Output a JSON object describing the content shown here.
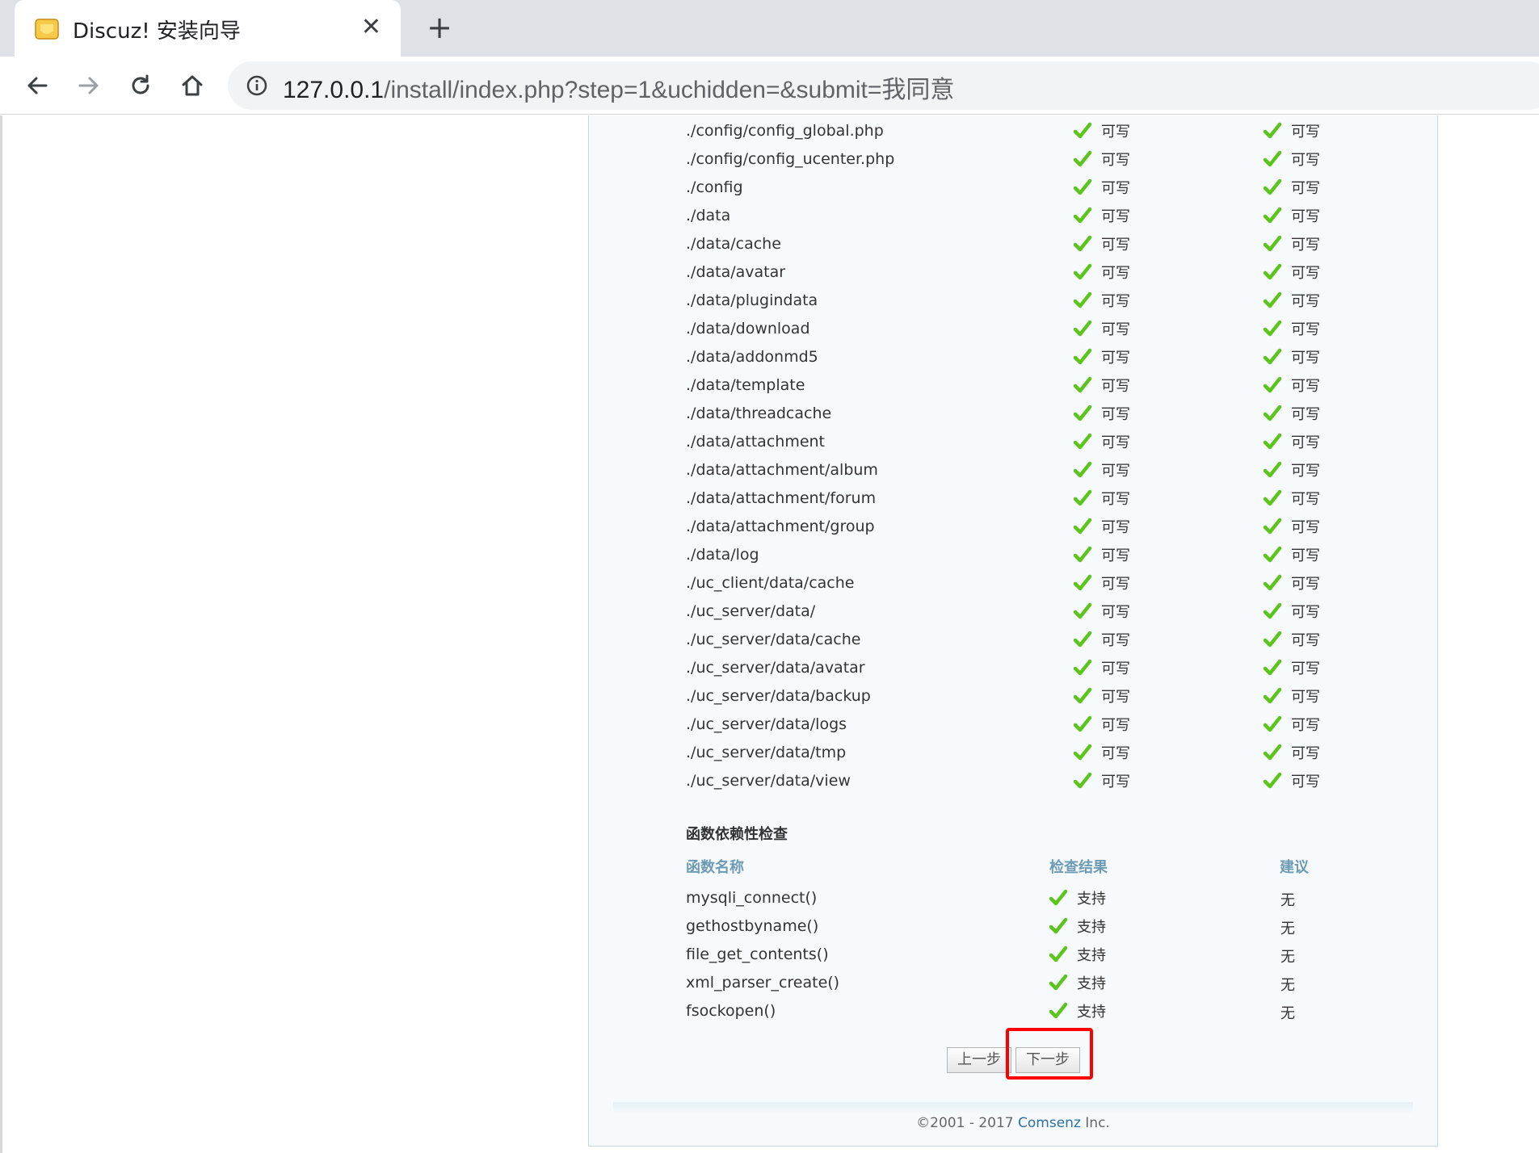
{
  "browser": {
    "tab_title": "Discuz! 安装向导",
    "favicon": "discuz-logo-icon",
    "url_host": "127.0.0.1",
    "url_path": "/install/index.php?step=1&uchidden=&submit=我同意"
  },
  "directory_check": {
    "rows": [
      {
        "path": "./config/config_global.php",
        "current": "可写",
        "required": "可写"
      },
      {
        "path": "./config/config_ucenter.php",
        "current": "可写",
        "required": "可写"
      },
      {
        "path": "./config",
        "current": "可写",
        "required": "可写"
      },
      {
        "path": "./data",
        "current": "可写",
        "required": "可写"
      },
      {
        "path": "./data/cache",
        "current": "可写",
        "required": "可写"
      },
      {
        "path": "./data/avatar",
        "current": "可写",
        "required": "可写"
      },
      {
        "path": "./data/plugindata",
        "current": "可写",
        "required": "可写"
      },
      {
        "path": "./data/download",
        "current": "可写",
        "required": "可写"
      },
      {
        "path": "./data/addonmd5",
        "current": "可写",
        "required": "可写"
      },
      {
        "path": "./data/template",
        "current": "可写",
        "required": "可写"
      },
      {
        "path": "./data/threadcache",
        "current": "可写",
        "required": "可写"
      },
      {
        "path": "./data/attachment",
        "current": "可写",
        "required": "可写"
      },
      {
        "path": "./data/attachment/album",
        "current": "可写",
        "required": "可写"
      },
      {
        "path": "./data/attachment/forum",
        "current": "可写",
        "required": "可写"
      },
      {
        "path": "./data/attachment/group",
        "current": "可写",
        "required": "可写"
      },
      {
        "path": "./data/log",
        "current": "可写",
        "required": "可写"
      },
      {
        "path": "./uc_client/data/cache",
        "current": "可写",
        "required": "可写"
      },
      {
        "path": "./uc_server/data/",
        "current": "可写",
        "required": "可写"
      },
      {
        "path": "./uc_server/data/cache",
        "current": "可写",
        "required": "可写"
      },
      {
        "path": "./uc_server/data/avatar",
        "current": "可写",
        "required": "可写"
      },
      {
        "path": "./uc_server/data/backup",
        "current": "可写",
        "required": "可写"
      },
      {
        "path": "./uc_server/data/logs",
        "current": "可写",
        "required": "可写"
      },
      {
        "path": "./uc_server/data/tmp",
        "current": "可写",
        "required": "可写"
      },
      {
        "path": "./uc_server/data/view",
        "current": "可写",
        "required": "可写"
      }
    ]
  },
  "function_check": {
    "title": "函数依赖性检查",
    "headers": {
      "name": "函数名称",
      "result": "检查结果",
      "advice": "建议"
    },
    "rows": [
      {
        "name": "mysqli_connect()",
        "result": "支持",
        "advice": "无"
      },
      {
        "name": "gethostbyname()",
        "result": "支持",
        "advice": "无"
      },
      {
        "name": "file_get_contents()",
        "result": "支持",
        "advice": "无"
      },
      {
        "name": "xml_parser_create()",
        "result": "支持",
        "advice": "无"
      },
      {
        "name": "fsockopen()",
        "result": "支持",
        "advice": "无"
      }
    ]
  },
  "buttons": {
    "prev": "上一步",
    "next": "下一步"
  },
  "footer": {
    "prefix": "©2001 - 2017 ",
    "link": "Comsenz",
    "suffix": " Inc."
  },
  "colors": {
    "check": "#5cc51c",
    "highlight": "#ff0000",
    "header_blue": "#6d9bb4"
  }
}
